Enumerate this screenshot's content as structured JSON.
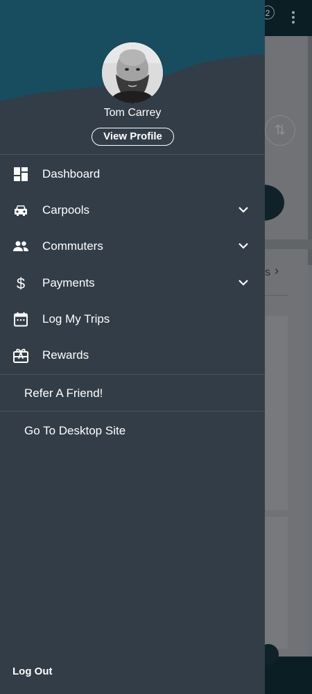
{
  "background_app": {
    "notification_count": "2",
    "link_text": "s"
  },
  "drawer": {
    "profile": {
      "name": "Tom Carrey",
      "view_profile_label": "View Profile",
      "avatar": "avatar-photo"
    },
    "menu": {
      "items": [
        {
          "label": "Dashboard",
          "icon": "dashboard-icon",
          "expandable": false
        },
        {
          "label": "Carpools",
          "icon": "car-icon",
          "expandable": true
        },
        {
          "label": "Commuters",
          "icon": "people-icon",
          "expandable": true
        },
        {
          "label": "Payments",
          "icon": "dollar-icon",
          "expandable": true
        },
        {
          "label": "Log My Trips",
          "icon": "calendar-icon",
          "expandable": false
        },
        {
          "label": "Rewards",
          "icon": "gift-icon",
          "expandable": false
        }
      ]
    },
    "links": {
      "refer": "Refer A Friend!",
      "desktop": "Go To Desktop Site"
    },
    "logout_label": "Log Out"
  },
  "colors": {
    "drawer_bg": "#333d48",
    "wave_teal": "#174d5f",
    "text": "#ffffff",
    "background_header": "#0b1e24"
  }
}
